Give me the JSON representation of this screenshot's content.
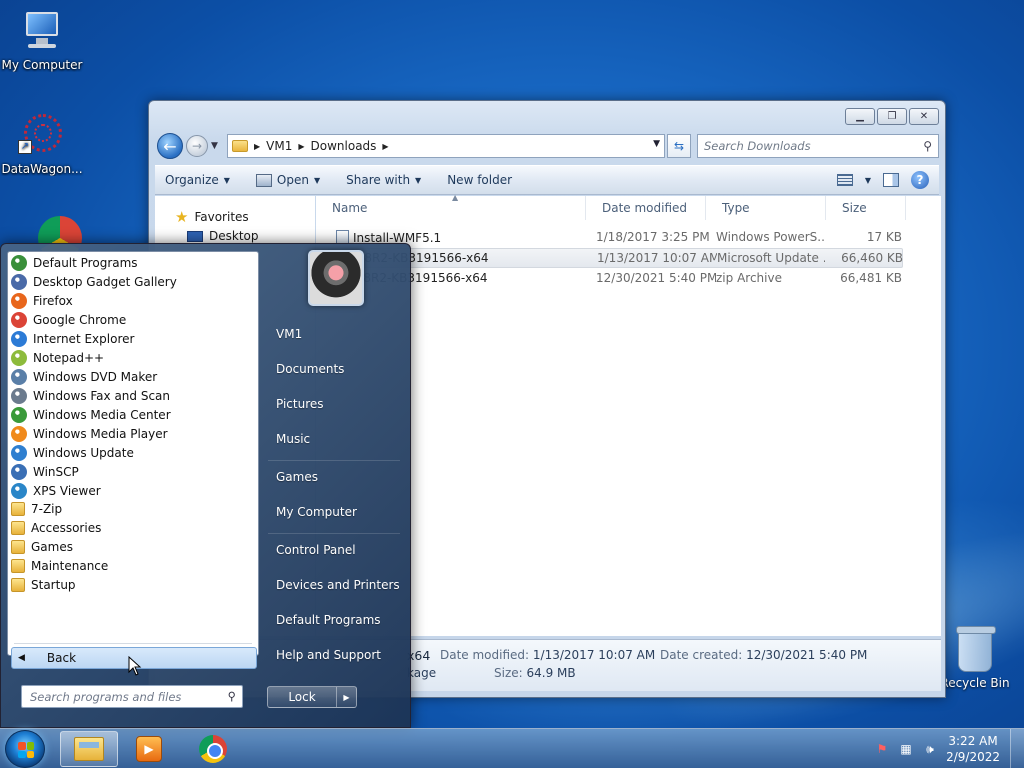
{
  "desktop": {
    "icons": [
      {
        "label": "My Computer"
      },
      {
        "label": "DataWagon..."
      },
      {
        "label": "Recycle Bin"
      }
    ]
  },
  "explorer": {
    "breadcrumb": [
      "VM1",
      "Downloads"
    ],
    "search_placeholder": "Search Downloads",
    "toolbar": {
      "organize": "Organize",
      "open": "Open",
      "share_with": "Share with",
      "new_folder": "New folder"
    },
    "nav": {
      "favorites": "Favorites",
      "desktop": "Desktop"
    },
    "columns": {
      "name": "Name",
      "date_modified": "Date modified",
      "type": "Type",
      "size": "Size"
    },
    "files": [
      {
        "name": "Install-WMF5.1",
        "date": "1/18/2017 3:25 PM",
        "type": "Windows PowerS...",
        "size": "17 KB"
      },
      {
        "name": "W2K8R2-KB3191566-x64",
        "date": "1/13/2017 10:07 AM",
        "type": "Microsoft Update ...",
        "size": "66,460 KB"
      },
      {
        "name": "W2K8R2-KB3191566-x64",
        "date": "12/30/2021 5:40 PM",
        "type": "zip Archive",
        "size": "66,481 KB"
      }
    ],
    "details": {
      "name_tail": "x64",
      "type_tail": "kage",
      "date_modified_label": "Date modified:",
      "date_modified_value": "1/13/2017 10:07 AM",
      "date_created_label": "Date created:",
      "date_created_value": "12/30/2021 5:40 PM",
      "size_label": "Size:",
      "size_value": "64.9 MB"
    }
  },
  "start_menu": {
    "programs": [
      {
        "label": "Default Programs",
        "color": "#3a8f3a"
      },
      {
        "label": "Desktop Gadget Gallery",
        "color": "#4a6aa8"
      },
      {
        "label": "Firefox",
        "color": "#e8661c"
      },
      {
        "label": "Google Chrome",
        "color": "#db4437"
      },
      {
        "label": "Internet Explorer",
        "color": "#2c7bd6"
      },
      {
        "label": "Notepad++",
        "color": "#8dbb3c"
      },
      {
        "label": "Windows DVD Maker",
        "color": "#5a7fa8"
      },
      {
        "label": "Windows Fax and Scan",
        "color": "#6b7b8e"
      },
      {
        "label": "Windows Media Center",
        "color": "#3a9a3a"
      },
      {
        "label": "Windows Media Player",
        "color": "#f08a1c"
      },
      {
        "label": "Windows Update",
        "color": "#2f7fd0"
      },
      {
        "label": "WinSCP",
        "color": "#3a6fb5"
      },
      {
        "label": "XPS Viewer",
        "color": "#2a86c8"
      },
      {
        "label": "7-Zip",
        "color": "folder"
      },
      {
        "label": "Accessories",
        "color": "folder"
      },
      {
        "label": "Games",
        "color": "folder"
      },
      {
        "label": "Maintenance",
        "color": "folder"
      },
      {
        "label": "Startup",
        "color": "folder"
      }
    ],
    "back_label": "Back",
    "search_placeholder": "Search programs and files",
    "right_items": [
      "VM1",
      "Documents",
      "Pictures",
      "Music",
      "Games",
      "My Computer",
      "Control Panel",
      "Devices and Printers",
      "Default Programs",
      "Help and Support"
    ],
    "lock_label": "Lock"
  },
  "taskbar": {
    "time": "3:22 AM",
    "date": "2/9/2022"
  }
}
